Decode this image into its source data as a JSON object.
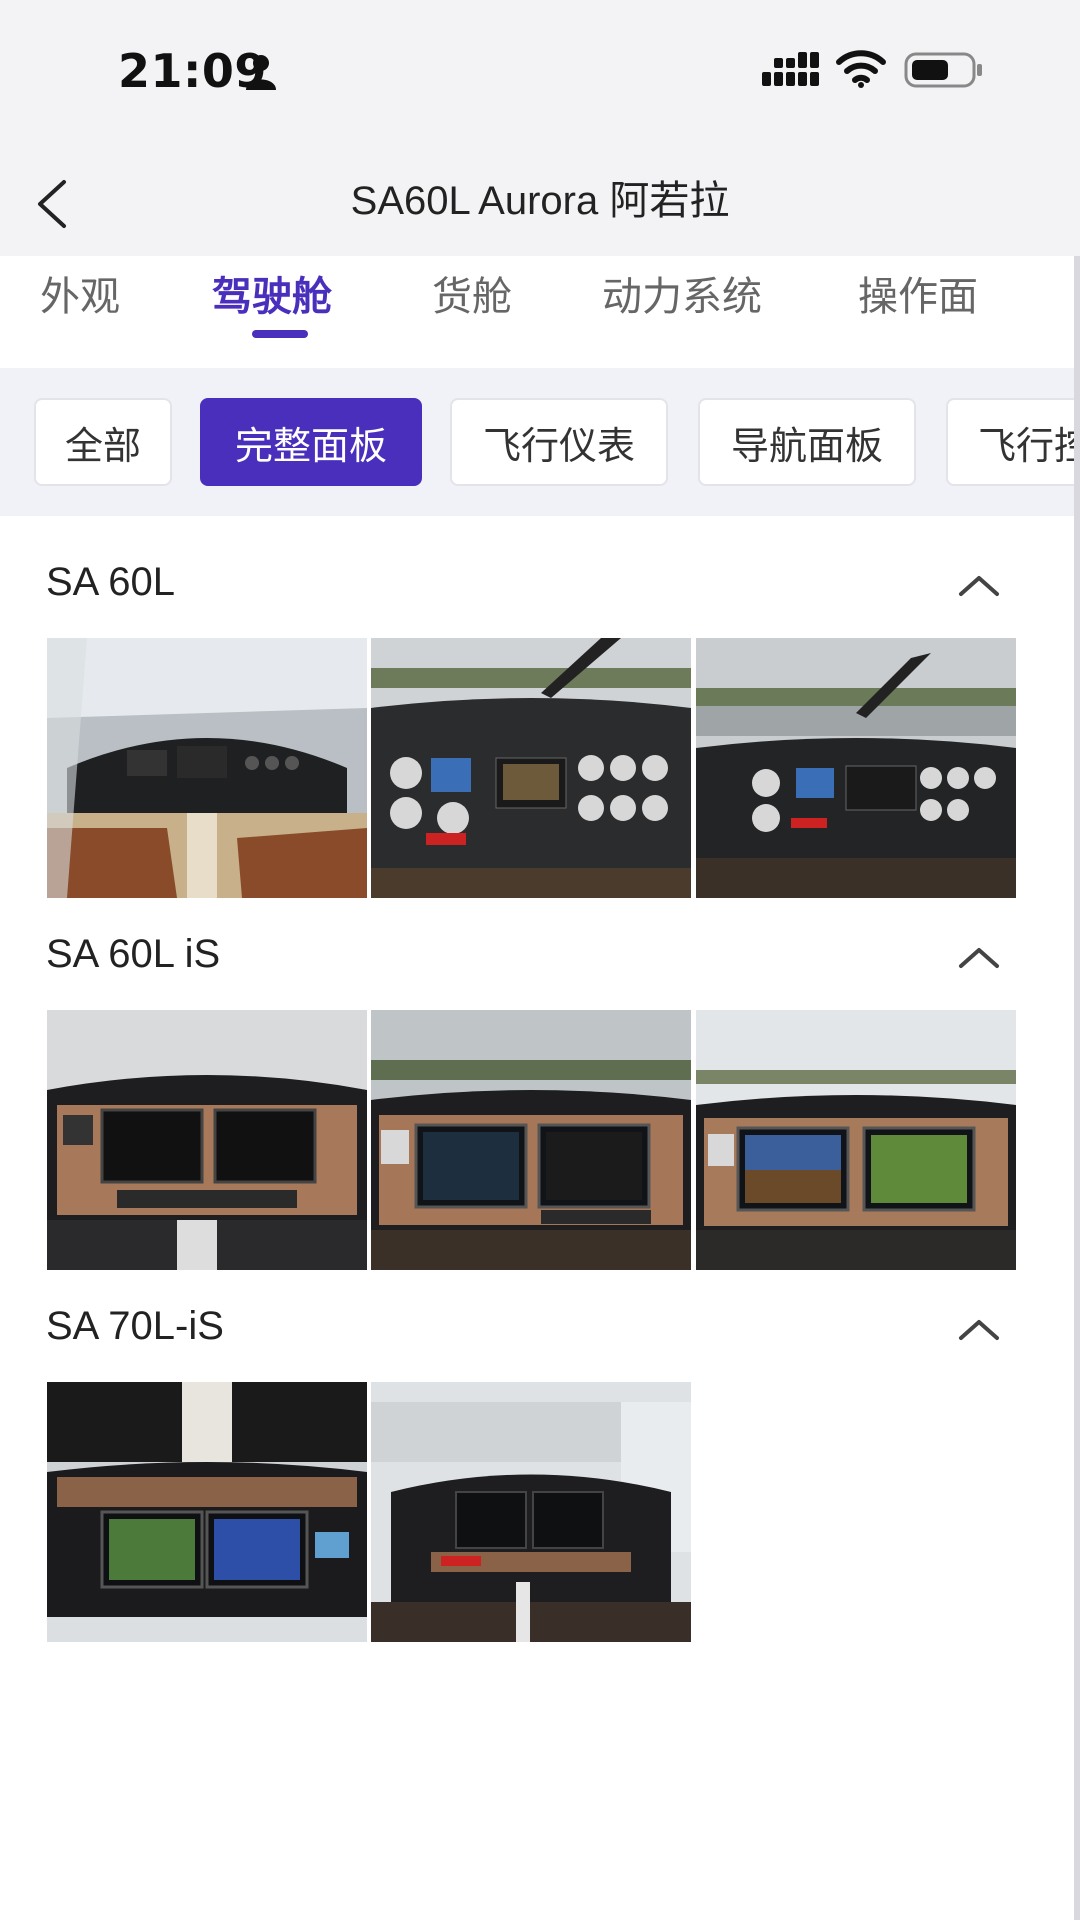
{
  "status_bar": {
    "time": "21:09",
    "icons": [
      "person-icon",
      "signal-icon",
      "wifi-icon",
      "battery-icon"
    ]
  },
  "nav": {
    "title": "SA60L Aurora 阿若拉",
    "back_icon": "chevron-left-icon"
  },
  "tabs": [
    {
      "label": "外观",
      "active": false
    },
    {
      "label": "驾驶舱",
      "active": true
    },
    {
      "label": "货舱",
      "active": false
    },
    {
      "label": "动力系统",
      "active": false
    },
    {
      "label": "操作面",
      "active": false
    }
  ],
  "filters": [
    {
      "label": "全部",
      "active": false
    },
    {
      "label": "完整面板",
      "active": true
    },
    {
      "label": "飞行仪表",
      "active": false
    },
    {
      "label": "导航面板",
      "active": false
    },
    {
      "label": "飞行控",
      "active": false
    }
  ],
  "sections": [
    {
      "title": "SA 60L",
      "collapse_icon": "chevron-up-icon",
      "photo_count": 3
    },
    {
      "title": "SA 60L iS",
      "collapse_icon": "chevron-up-icon",
      "photo_count": 3
    },
    {
      "title": "SA 70L-iS",
      "collapse_icon": "chevron-up-icon",
      "photo_count": 2
    }
  ],
  "colors": {
    "accent": "#4a2fbd",
    "header_bg": "#f3f3f5",
    "filter_bg": "#f1f1f8"
  }
}
